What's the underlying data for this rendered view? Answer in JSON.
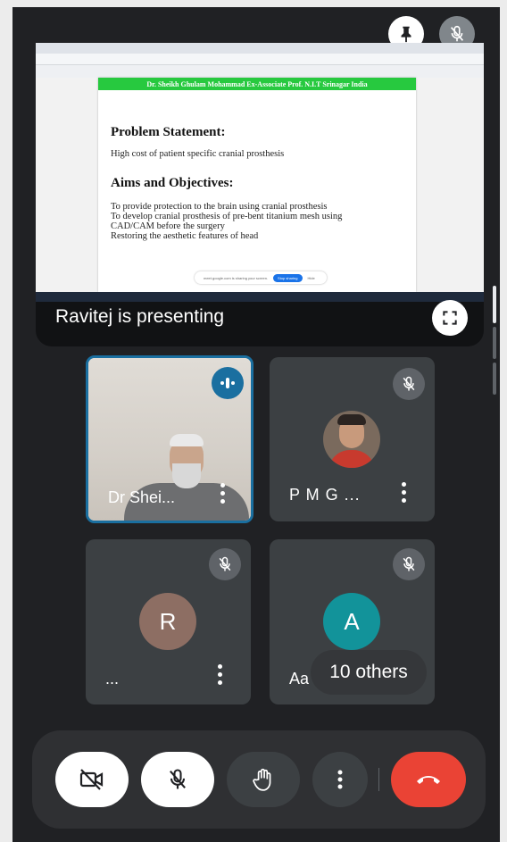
{
  "presentation": {
    "doc_header": "Dr. Sheikh Ghulam Mohammad    Ex-Associate Prof. N.I.T Srinagar India",
    "problem_heading": "Problem Statement:",
    "problem_text": "High cost of patient specific cranial prosthesis",
    "aims_heading": "Aims and Objectives:",
    "aims_lines": [
      "To provide protection to the brain using cranial prosthesis",
      "To develop cranial prosthesis of pre-bent titanium mesh using",
      "CAD/CAM before the surgery",
      "Restoring the aesthetic features of head"
    ],
    "share_notice": "meet.google.com is sharing your screen.",
    "share_stop": "Stop sharing",
    "share_hide": "Hide",
    "presenting_label": "Ravitej is presenting"
  },
  "participants": [
    {
      "name": "Dr Shei...",
      "speaking": true,
      "has_video": true
    },
    {
      "name": "P M G ...",
      "muted": true,
      "avatar_type": "photo"
    },
    {
      "name": "...",
      "muted": true,
      "avatar_letter": "R",
      "avatar_color": "#8d6e63"
    },
    {
      "name": "Aa",
      "muted": true,
      "avatar_letter": "A",
      "avatar_color": "#12939a"
    }
  ],
  "others_label": "10 others",
  "colors": {
    "background": "#202124",
    "tile": "#3c4043",
    "speaking_border": "#1a6fa0",
    "end_call": "#ea4335",
    "doc_header_green": "#27c93f"
  },
  "icons": {
    "pin": "pin-icon",
    "top_mic": "mic-off-icon",
    "fullscreen": "fullscreen-icon",
    "camera": "camera-off-icon",
    "mic": "mic-off-icon",
    "hand": "hand-icon",
    "more": "more-vert-icon",
    "end_call": "call-end-icon"
  }
}
